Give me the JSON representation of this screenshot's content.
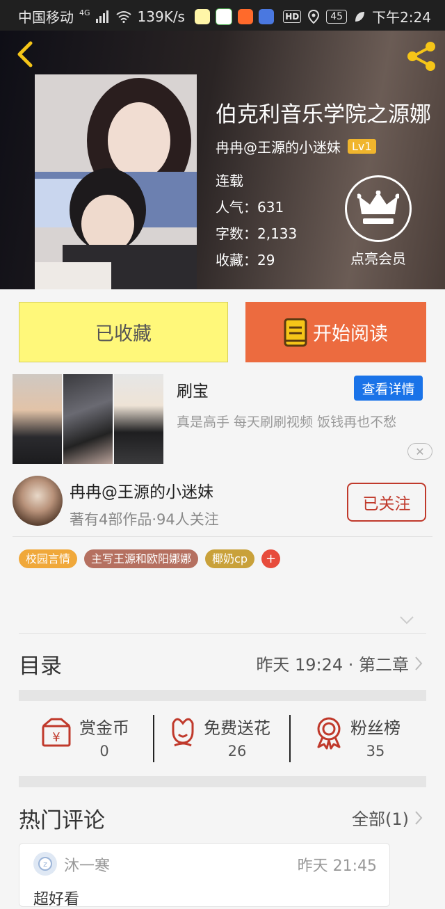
{
  "status_bar": {
    "carrier": "中国移动",
    "net_type": "4G",
    "speed": "139K/s",
    "battery": "45",
    "time": "下午2:24",
    "hd": "HD"
  },
  "book": {
    "title": "伯克利音乐学院之源娜",
    "author": "冉冉@王源的小迷妹",
    "level": "Lv1",
    "status": "连载",
    "popularity": "人气：631",
    "words": "字数：2,133",
    "favorites": "收藏：29",
    "vip_label": "点亮会员"
  },
  "actions": {
    "favorite_label": "已收藏",
    "read_label": "开始阅读"
  },
  "ad": {
    "title": "刷宝",
    "button": "查看详情",
    "description": "真是高手 每天刷刷视频 饭钱再也不愁",
    "close": "✕"
  },
  "author_card": {
    "name": "冉冉@王源的小迷妹",
    "stats": "著有4部作品·94人关注",
    "follow_label": "已关注"
  },
  "tags": [
    {
      "label": "校园言情",
      "color": "#f0a83a"
    },
    {
      "label": "主写王源和欧阳娜娜",
      "color": "#b57060"
    },
    {
      "label": "椰奶cp",
      "color": "#c9a13a"
    }
  ],
  "tag_add": "+",
  "catalog": {
    "title": "目录",
    "update": "昨天 19:24 · 第二章"
  },
  "stats": [
    {
      "label": "赏金币",
      "value": "0",
      "icon": "reward-coin-icon"
    },
    {
      "label": "免费送花",
      "value": "26",
      "icon": "flower-icon"
    },
    {
      "label": "粉丝榜",
      "value": "35",
      "icon": "medal-icon"
    }
  ],
  "comments": {
    "title": "热门评论",
    "all_label": "全部(1)",
    "items": [
      {
        "user": "沐一寒",
        "time": "昨天 21:45",
        "text": "超好看"
      }
    ]
  },
  "colors": {
    "accent_orange": "#ec6b3f",
    "favorite_yellow": "#fff87a",
    "follow_red": "#c0392b",
    "ad_blue": "#1a73e8",
    "icon_red": "#c0392b"
  }
}
